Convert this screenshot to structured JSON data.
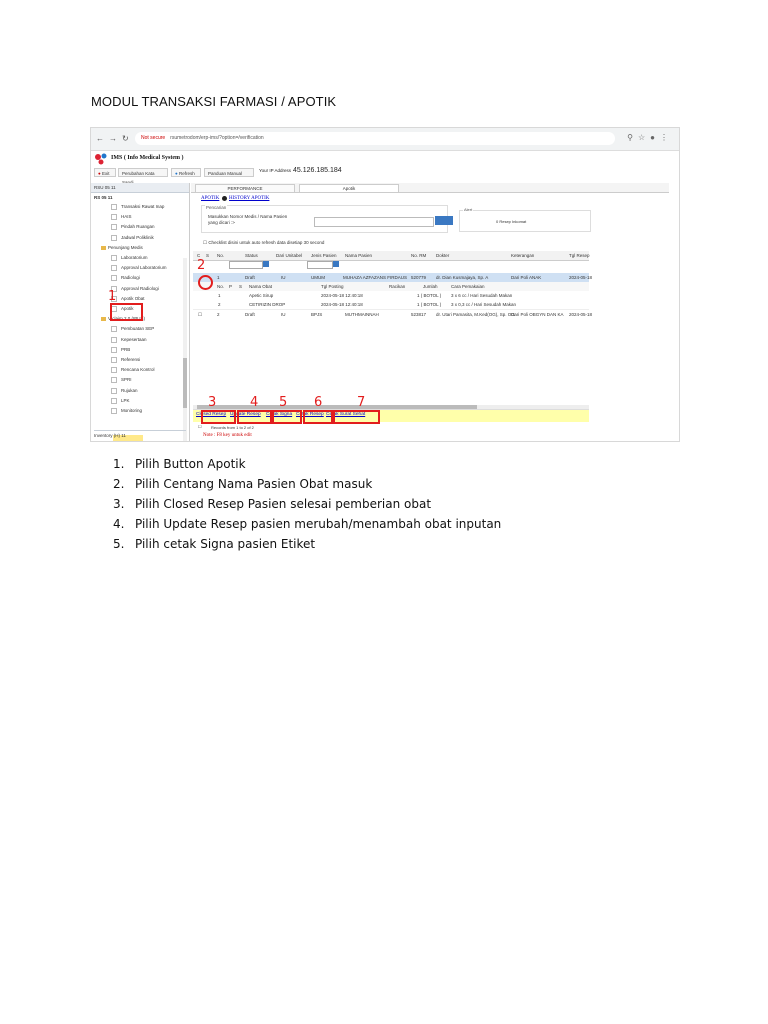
{
  "document": {
    "title": "MODUL TRANSAKSI FARMASI / APOTIK",
    "steps": [
      {
        "num": "1.",
        "text": "Pilih Button Apotik"
      },
      {
        "num": "2.",
        "text": "Pilih Centang Nama Pasien Obat masuk"
      },
      {
        "num": "3.",
        "text": "Pilih Closed Resep Pasien selesai pemberian obat"
      },
      {
        "num": "4.",
        "text": "Pilih Update Resep pasien merubah/menambah obat inputan"
      },
      {
        "num": "5.",
        "text": "Pilih cetak Signa pasien Etiket"
      }
    ]
  },
  "screenshot": {
    "browser": {
      "not_secure": "Not secure",
      "url": "rsumetrodom/erp-ims/?option=/verification",
      "icons": [
        "back-icon",
        "forward-icon",
        "reload-icon",
        "zoom-icon",
        "star-icon",
        "profile-icon",
        "menu-icon"
      ]
    },
    "app": {
      "name": "IMS ( Info Medical System )",
      "toolbar": {
        "exit": "Exit",
        "change_password": "Perubahan Kata Sandi",
        "refresh": "Refresh",
        "manual": "Panduan Manual",
        "ip_label": "Your IP Address",
        "ip_value": "45.126.185.184"
      }
    },
    "sidebar": {
      "header": "RSU 05 11",
      "tree_root": "RS 05 11",
      "items": [
        "Transaksi Rawat Inap",
        "HAIS",
        "Pindah Ruangan",
        "Jadwal Poliklinik",
        "Penunjang Medis",
        "Laboratorium",
        "Approval Laboratorium",
        "Radiologi",
        "Approval Radiologi",
        "Apotik Obat",
        "Apotik",
        "V-claim 2.0 (IPUS)",
        "Pembuatan SEP",
        "Kepesertaan",
        "PRB",
        "Referensi",
        "Rencana Kontrol",
        "SPRI",
        "Rujukan",
        "LPK",
        "Monitoring"
      ],
      "footer": "Inventory (H) 11"
    },
    "tabs": [
      "PERFORMANCE",
      "Apotik"
    ],
    "links": {
      "apotik": "APOTIK",
      "history": "HISTORY APOTIK"
    },
    "search": {
      "legend": "Pencarian",
      "label": "Masukkan Nomor Medis / Nama Pasien yang dicari :>"
    },
    "alert": {
      "legend": "Alert",
      "text": "0 Resep Inkomat"
    },
    "auto_refresh": "Checklist disini untuk auto refresh data disetiap 30 second",
    "grid": {
      "headers": [
        "C",
        "S",
        "No.",
        "Status",
        "Dari Unitabel",
        "Jenis Pasien",
        "Nama Pasien",
        "No. RM",
        "Dokter",
        "Keterangan",
        "Tgl Resep"
      ],
      "rows": [
        {
          "no": "1",
          "status": "Draft",
          "unit": "IU",
          "jenis": "UMUM",
          "nama": "MUHAZA AZFAZANS FIRDAUS",
          "rm": "520779",
          "dokter": "dr. Dian Kusmajaya, Sp. A",
          "ket": "Dari Poli ANAK",
          "tgl": "2024-05-18"
        },
        {
          "no": "2",
          "status": "Draft",
          "unit": "IU",
          "jenis": "BPJS",
          "nama": "MUTHMAINNAH",
          "rm": "523817",
          "dokter": "dr. Utari Pamasita, M.Ked(OG), Sp. OG",
          "ket": "Dari Poli OBGYN DAN KA",
          "tgl": "2024-05-18"
        }
      ],
      "sub_headers": [
        "No.",
        "P",
        "S",
        "Nama Obat",
        "Tgl Posting",
        "Racikan",
        "Jumlah",
        "Cara Pemakaian"
      ],
      "sub_rows": [
        {
          "no": "1",
          "nama": "Apetic Sirup",
          "tgl": "2024-05-18 12:40:18",
          "jumlah": "1 ( BOTOL )",
          "cara": "3 x 6 cc / Hari Sesudah Makan"
        },
        {
          "no": "2",
          "nama": "CETIRIZIN DROP",
          "tgl": "2024-05-18 12:40:18",
          "jumlah": "1 ( BOTOL )",
          "cara": "3 x 0,3 cc / Hari Sesudah Makan"
        }
      ]
    },
    "actions": [
      "Closed Resep",
      "Update Resep",
      "Cetak Signa",
      "Cetak Resep",
      "Cetak Surat Sehat"
    ],
    "records": "Records from 1 to 2 of 2",
    "note": "Note : F8 key untuk edit",
    "markers": [
      "1",
      "2",
      "3",
      "4",
      "5",
      "6",
      "7"
    ]
  }
}
